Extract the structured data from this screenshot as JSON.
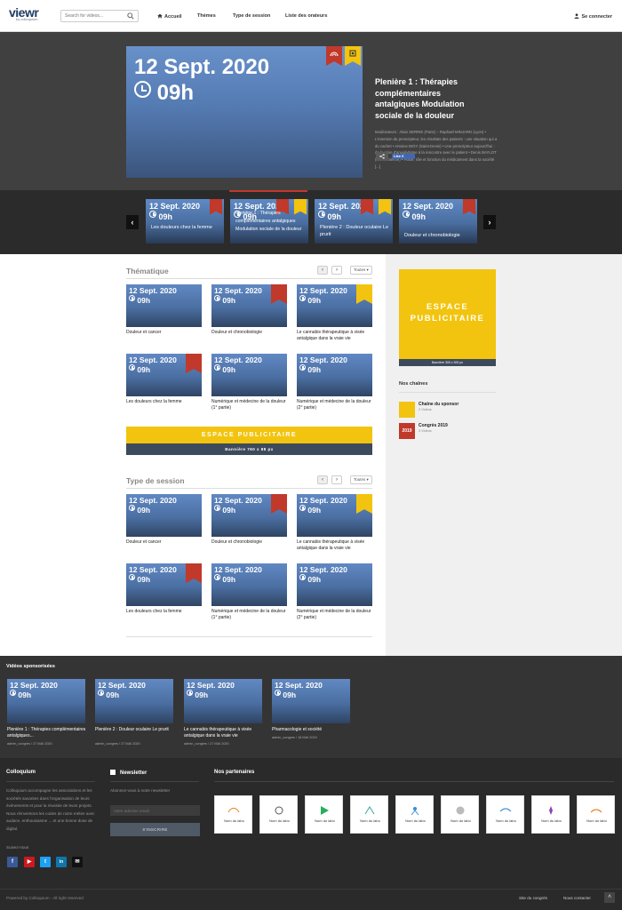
{
  "header": {
    "logo": "viewr",
    "logo_sub": "by colloquium",
    "search_placeholder": "Search for videos...",
    "nav": [
      "Accueil",
      "Thèmes",
      "Type de session",
      "Liste des orateurs"
    ],
    "login": "Se connecter"
  },
  "hero": {
    "date": "12 Sept. 2020",
    "time": "09h",
    "title": "Plenière 1 : Thérapies complémentaires antalgiques Modulation sociale de la douleur",
    "description": "Modérateurs : Alain SERRIE (Paris) – Raphaël MINJARD (Lyon) • L'intention du prescripteur, les résultats des patients : une situation qui a du cachet • Antoine BIOY (Saint-Denis) • Une prescripteur aujourd'hui : de la crise d'anxiolytisme à la rencontre avec le patient • Denis BAYLOT (Saint-Etienne) • Place, rôle et fonction du médicament dans la société [...]",
    "like_label": "Like 0"
  },
  "carousel": [
    {
      "date": "12 Sept. 2020",
      "time": "09h",
      "title": "Les douleurs chez la femme"
    },
    {
      "date": "12 Sept. 2020",
      "time": "09h",
      "title": "Plenière 1 : Thérapies complémentaires antalgiques Modulation sociale de la douleur"
    },
    {
      "date": "12 Sept. 2020",
      "time": "09h",
      "title": "Plenière 2 : Douleur oculaire Le prurit"
    },
    {
      "date": "12 Sept. 2020",
      "time": "09h",
      "title": "Douleur et chronobiologie"
    }
  ],
  "thematique": {
    "heading": "Thématique",
    "select": "Toutes",
    "items": [
      {
        "date": "12 Sept. 2020",
        "time": "09h",
        "caption": "Douleur et cancer"
      },
      {
        "date": "12 Sept. 2020",
        "time": "09h",
        "caption": "Douleur et chronobiologie"
      },
      {
        "date": "12 Sept. 2020",
        "time": "09h",
        "caption": "Le cannabis thérapeutique à visée antalgique dans la vraie vie"
      },
      {
        "date": "12 Sept. 2020",
        "time": "09h",
        "caption": "Les douleurs chez la femme"
      },
      {
        "date": "12 Sept. 2020",
        "time": "09h",
        "caption": "Numérique et médecine de la douleur (1° partie)"
      },
      {
        "date": "12 Sept. 2020",
        "time": "09h",
        "caption": "Numérique et médecine de la douleur (2° partie)"
      }
    ]
  },
  "banner": {
    "title": "ESPACE PUBLICITAIRE",
    "sub": "Bannière 760 x 88 px"
  },
  "session": {
    "heading": "Type de session",
    "select": "Toutes",
    "items": [
      {
        "date": "12 Sept. 2020",
        "time": "09h",
        "caption": "Douleur et cancer"
      },
      {
        "date": "12 Sept. 2020",
        "time": "09h",
        "caption": "Douleur et chronobiologie"
      },
      {
        "date": "12 Sept. 2020",
        "time": "09h",
        "caption": "Le cannabis thérapeutique à visée antalgique dans la vraie vie"
      },
      {
        "date": "12 Sept. 2020",
        "time": "09h",
        "caption": "Les douleurs chez la femme"
      },
      {
        "date": "12 Sept. 2020",
        "time": "09h",
        "caption": "Numérique et médecine de la douleur (1° partie)"
      },
      {
        "date": "12 Sept. 2020",
        "time": "09h",
        "caption": "Numérique et médecine de la douleur (2° partie)"
      }
    ]
  },
  "sidebar": {
    "ad_title": "ESPACE PUBLICITAIRE",
    "ad_sub": "Bannière 300 x 300 px",
    "channels_heading": "Nos chaînes",
    "channels": [
      {
        "name": "Chaîne du sponsor",
        "count": "2 Vidéos",
        "badge": "",
        "color": "#f2c40f"
      },
      {
        "name": "Congrès 2019",
        "count": "3 Vidéos",
        "badge": "2019",
        "color": "#c0392b"
      }
    ]
  },
  "sponsored": {
    "heading": "Vidéos sponsorisées",
    "items": [
      {
        "date": "12 Sept. 2020",
        "time": "09h",
        "caption": "Plenière 1 : Thérapies complémentaires antalgiques...",
        "meta": "admin_congres  /  27 MAI 2020"
      },
      {
        "date": "12 Sept. 2020",
        "time": "09h",
        "caption": "Plenière 2 : Douleur oculaire Le prurit",
        "meta": "admin_congres  /  27 MAI 2020"
      },
      {
        "date": "12 Sept. 2020",
        "time": "09h",
        "caption": "Le cannabis thérapeutique à visée antalgique dans la vraie vie",
        "meta": "admin_congres  /  27 MAI 2020"
      },
      {
        "date": "12 Sept. 2020",
        "time": "09h",
        "caption": "Pharmacologie et société",
        "meta": "admin_congres  /  18 MAI 2019"
      }
    ]
  },
  "footer": {
    "about_heading": "Colloquium",
    "about_text": "Colloquium accompagne les associations et les sociétés savantes dans l'organisation de leurs évènements et pour la réussite de leurs projets. Nous réinventons les codes de notre métier avec audace, enthousiasme ... et une bonne dose de digital.",
    "follow": "Suivez-nous",
    "newsletter_heading": "Newsletter",
    "newsletter_text": "Abonnez-vous à notre newsletter",
    "email_placeholder": "Votre adresse email",
    "subscribe": "S'INSCRIRE",
    "partners_heading": "Nos partenaires",
    "partners": [
      "Nom du labo",
      "Nom du labo",
      "Nom du labo",
      "Nom du labo",
      "Nom du labo",
      "Nom du labo",
      "Nom du labo",
      "Nom du labo",
      "Nom du labo"
    ],
    "copyright": "Powered by Colloquium - All right reserved",
    "links": [
      "Site du congrès",
      "Nous contacter"
    ]
  },
  "colors": {
    "ribbon_red": "#c0392b",
    "ribbon_yellow": "#f2c40f",
    "banner_yellow": "#f2c40f",
    "banner_dark": "#3d4a5c"
  }
}
